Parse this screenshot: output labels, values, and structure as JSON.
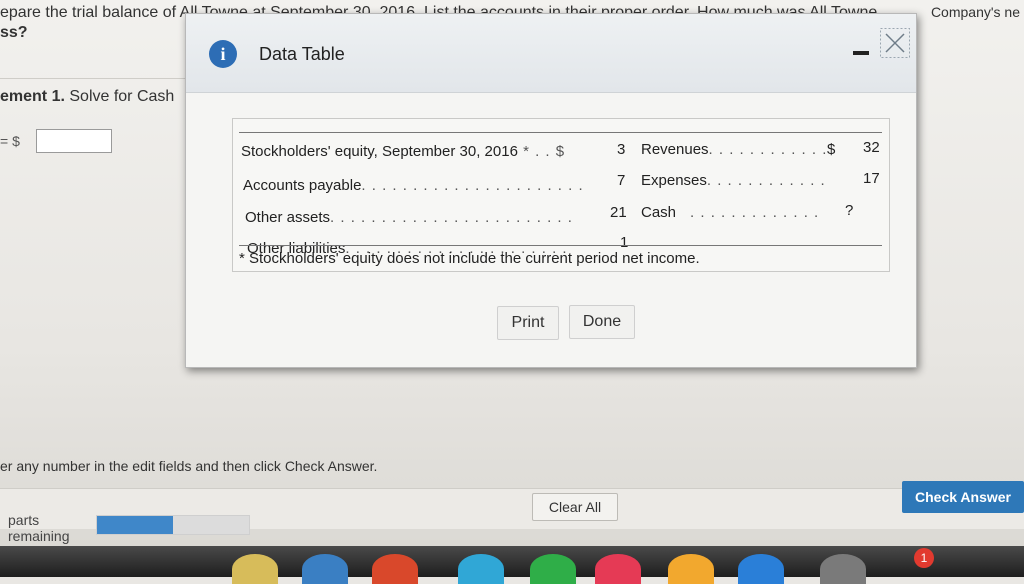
{
  "background": {
    "question_line1": "epare the trial balance of All Towne at September 30, 2016. List the accounts in their proper order. How much was All Towne",
    "question_line1_right": "Company's ne",
    "question_line2": "ss?",
    "requirement_label": "ement 1.",
    "requirement_text": " Solve for Cash",
    "equation_label": "= $",
    "instructions": "er any number in the edit fields and then click Check Answer.",
    "parts_label_1": "parts",
    "parts_label_2": "remaining",
    "progress_fraction": 0.5,
    "clear_all": "Clear All",
    "check_answer": "Check Answer"
  },
  "dialog": {
    "info_glyph": "i",
    "title": "Data Table",
    "rows_left": [
      {
        "label": "Stockholders' equity, September 30, 2016",
        "marker": " * . . $",
        "value": "3"
      },
      {
        "label": "Accounts payable",
        "dots": ". . . . . . . . . . . . . . . . . . . . . .",
        "value": "7"
      },
      {
        "label": "Other assets",
        "dots": ". . . . . . . . . . . . . . . . . . . . . . . .",
        "value": "21"
      },
      {
        "label": "Other liabilities",
        "dots": ". . . . . . . . . . . . . . . . . . . . . .",
        "value": "1"
      }
    ],
    "rows_right": [
      {
        "label": "Revenues",
        "dots": ". . . . . . . . . . . .",
        "currency": "$",
        "value": "32"
      },
      {
        "label": "Expenses",
        "dots": ". . . . . . . . . . . .",
        "currency": "",
        "value": "17"
      },
      {
        "label": "Cash",
        "dots": ". . . . . . . . . . . . .",
        "currency": "",
        "value": "?"
      }
    ],
    "footnote": "* Stockholders' equity does not include the current period net income.",
    "print": "Print",
    "done": "Done"
  },
  "dock": {
    "colors": [
      "#d7bc5a",
      "#3a7fc3",
      "#d9482b",
      "#30a7d6",
      "#2fae48",
      "#e53a55",
      "#f2a82e",
      "#2a7fd8",
      "#7a7a7a"
    ],
    "badge": "1"
  }
}
